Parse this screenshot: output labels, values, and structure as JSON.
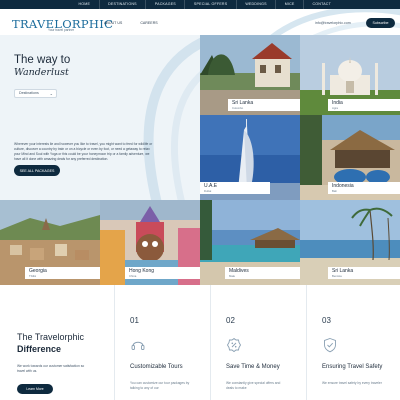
{
  "top_nav": [
    "HOME",
    "DESTINATIONS",
    "PACKAGES",
    "SPECIAL OFFERS",
    "WEDDINGS",
    "MICE",
    "CONTACT"
  ],
  "header": {
    "logo": "TRAVELORPHIC",
    "tagline": "Your travel partner",
    "nav": [
      "ABOUT US",
      "CAREERS"
    ],
    "email": "info@travelorphic.com",
    "subscribe": "Subscribe"
  },
  "hero": {
    "title": "The way to",
    "subtitle": "Wanderlust",
    "select_value": "Destinations",
    "body": "Wherever your interests lie and however you like to travel, you might want to feed for wildlife or culture, discover a country by train or on a bicycle or even by foot, or need a getaway to relax your Mind and Soul with Yoga or this could be your honeymoon trip or a family adventure, we have all it done with amazing deals for any preferred destination.",
    "button": "SEE ALL PACKAGES"
  },
  "destinations": [
    {
      "name": "Sri Lanka",
      "sub": "Colombo"
    },
    {
      "name": "India",
      "sub": "Agra"
    },
    {
      "name": "U.A.E",
      "sub": "Dubai"
    },
    {
      "name": "Indonesia",
      "sub": "Bali"
    },
    {
      "name": "Georgia",
      "sub": "Tbilisi"
    },
    {
      "name": "Hong Kong",
      "sub": "China"
    },
    {
      "name": "Maldives",
      "sub": "Male"
    },
    {
      "name": "Sri Lanka",
      "sub": "Bentota"
    }
  ],
  "difference": {
    "title_line1": "The Travelorphic",
    "title_line2": "Difference",
    "text": "We work towards our customer satisfaction so travel with us.",
    "button": "Learn More"
  },
  "features": [
    {
      "num": "01",
      "title": "Customizable Tours",
      "text": "You can customize our tour packages by talking to any of our",
      "icon": "headset-icon"
    },
    {
      "num": "02",
      "title": "Save Time & Money",
      "text": "We constantly give special offers and deals to make",
      "icon": "badge-percent-icon"
    },
    {
      "num": "03",
      "title": "Ensuring Travel Safety",
      "text": "We ensure travel safety by every traveler",
      "icon": "shield-icon"
    }
  ],
  "colors": {
    "navy": "#0e2a3f",
    "accent": "#1b6c9c",
    "hero_bg": "#eef4f8"
  }
}
